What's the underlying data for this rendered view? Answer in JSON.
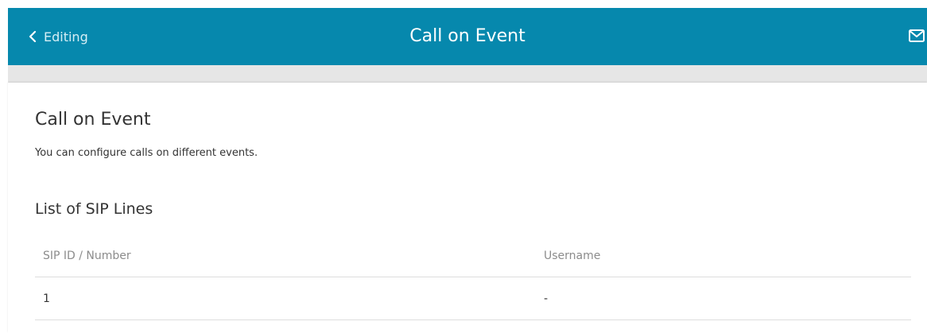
{
  "header": {
    "back_label": "Editing",
    "title": "Call on Event",
    "accent_color": "#0688ad",
    "back_icon": "chevron-left-icon",
    "mail_icon": "envelope-icon"
  },
  "main": {
    "heading": "Call on Event",
    "description": "You can configure calls on different events.",
    "section_title": "List of SIP Lines",
    "table": {
      "columns": [
        "SIP ID / Number",
        "Username"
      ],
      "rows": [
        [
          "1",
          "-"
        ]
      ]
    }
  }
}
